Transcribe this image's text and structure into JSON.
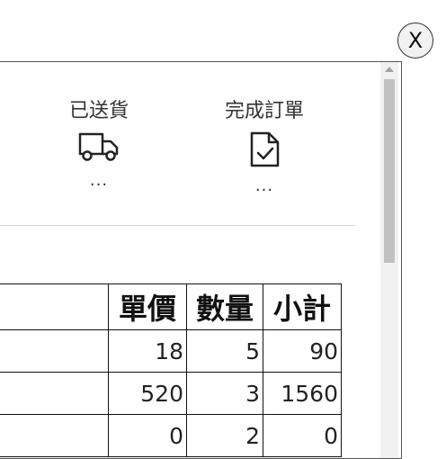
{
  "close_button": {
    "label": "X",
    "icon": "close-icon"
  },
  "steps": [
    {
      "label": "已送貨",
      "icon": "truck-icon",
      "status": "..."
    },
    {
      "label": "完成訂單",
      "icon": "document-check-icon",
      "status": "..."
    }
  ],
  "table": {
    "headers": [
      "",
      "單價",
      "數量",
      "小計"
    ],
    "rows": [
      [
        "",
        "18",
        "5",
        "90"
      ],
      [
        "",
        "520",
        "3",
        "1560"
      ],
      [
        "",
        "0",
        "2",
        "0"
      ]
    ]
  }
}
